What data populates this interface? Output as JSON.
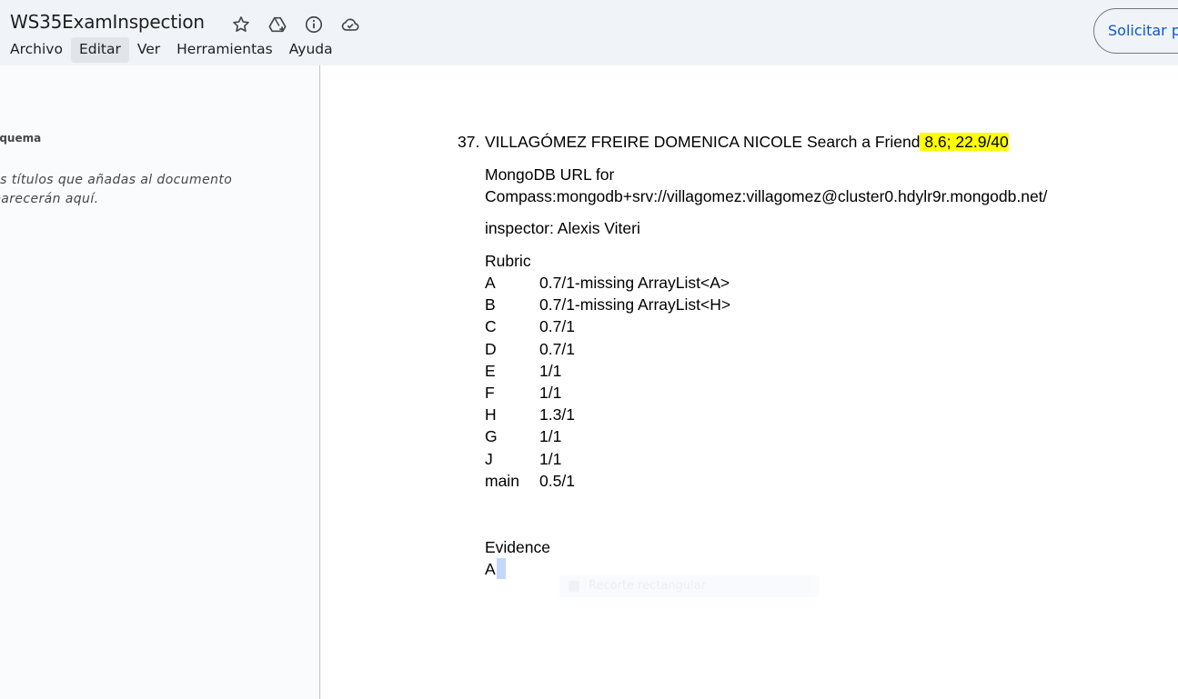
{
  "header": {
    "title": "WS35ExamInspection",
    "icons": [
      "star-icon",
      "move-to-drive-icon",
      "info-icon",
      "cloud-saved-icon"
    ],
    "menu": [
      "Archivo",
      "Editar",
      "Ver",
      "Herramientas",
      "Ayuda"
    ],
    "active_menu": "Editar",
    "share_label": "Solicitar permiso"
  },
  "outline": {
    "heading": "Esquema",
    "empty_text": "Los títulos que añadas al documento aparecerán aquí."
  },
  "document": {
    "item_number": "37.",
    "student_name": "VILLAGÓMEZ FREIRE DOMENICA NICOLE Search a Friend",
    "score_highlight": " 8.6;  22.9/40",
    "url_label": "MongoDB URL for",
    "url_value": "Compass:mongodb+srv://villagomez:villagomez@cluster0.hdylr9r.mongodb.net/",
    "inspector": "inspector: Alexis Viteri",
    "rubric_title": "Rubric",
    "rubric": [
      {
        "key": "A",
        "value": "0.7/1-missing ArrayList<A>"
      },
      {
        "key": "B",
        "value": "0.7/1-missing ArrayList<H>"
      },
      {
        "key": "C",
        "value": "0.7/1"
      },
      {
        "key": "D",
        "value": "0.7/1"
      },
      {
        "key": "E",
        "value": "1/1"
      },
      {
        "key": "F",
        "value": "1/1"
      },
      {
        "key": "H",
        "value": "1.3/1"
      },
      {
        "key": "G",
        "value": "1/1"
      },
      {
        "key": "J",
        "value": "1/1"
      },
      {
        "key": "main",
        "value": "0.5/1"
      }
    ],
    "evidence_title": "Evidence",
    "evidence_first": "A",
    "ghost_tooltip": "Recorte rectangular"
  },
  "colors": {
    "highlight": "#ffff00",
    "accent": "#0b57d0",
    "selection": "#c2d7fb"
  }
}
